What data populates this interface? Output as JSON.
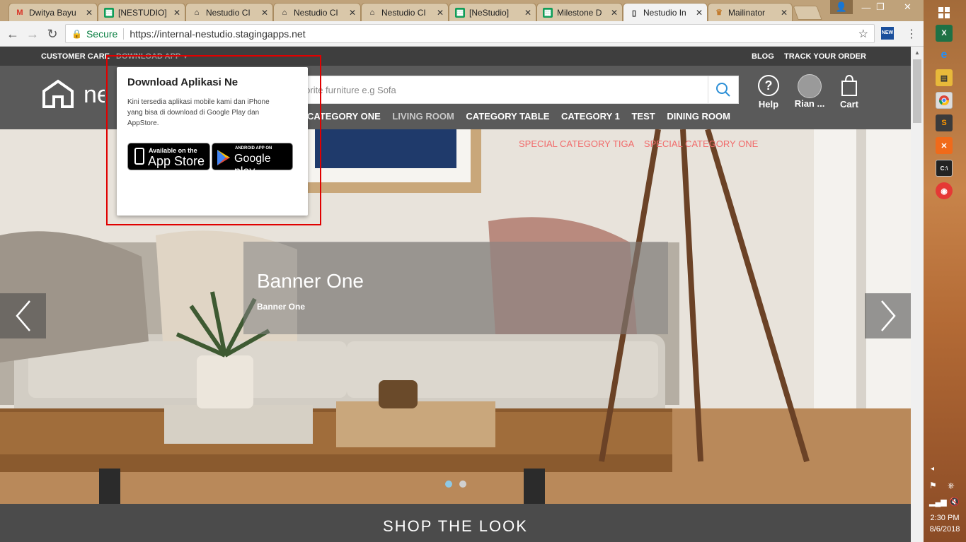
{
  "browser": {
    "tabs": [
      {
        "label": "Dwitya Bayu",
        "icon": "gmail-icon",
        "active": false
      },
      {
        "label": "[NESTUDIO]",
        "icon": "sheets-icon",
        "active": false
      },
      {
        "label": "Nestudio CI",
        "icon": "nestudio-icon",
        "active": false
      },
      {
        "label": "Nestudio CI",
        "icon": "nestudio-icon",
        "active": false
      },
      {
        "label": "Nestudio CI",
        "icon": "nestudio-icon",
        "active": false
      },
      {
        "label": "[NeStudio]",
        "icon": "sheets-icon",
        "active": false
      },
      {
        "label": "Milestone D",
        "icon": "sheets-icon",
        "active": false
      },
      {
        "label": "Nestudio In",
        "icon": "page-icon",
        "active": true
      },
      {
        "label": "Mailinator",
        "icon": "mailinator-icon",
        "active": false
      }
    ],
    "secure_label": "Secure",
    "url": "https://internal-nestudio.stagingapps.net"
  },
  "site": {
    "topbar": {
      "customer_care": "CUSTOMER CARE",
      "download_app": "DOWNLOAD APP",
      "blog": "BLOG",
      "track_order": "TRACK YOUR ORDER"
    },
    "search": {
      "placeholder": "Find your favorite furniture e.g Sofa"
    },
    "header_icons": {
      "help": "Help",
      "user": "Rian ...",
      "cart": "Cart"
    },
    "categories": [
      "CATEGORY ONE",
      "LIVING ROOM",
      "CATEGORY TABLE",
      "CATEGORY 1",
      "TEST",
      "DINING ROOM"
    ],
    "special_categories": [
      "SPECIAL CATEGORY TIGA",
      "SPECIAL CATEGORY ONE"
    ],
    "banner": {
      "title": "Banner One",
      "subtitle": "Banner One"
    },
    "shop_the_look": "SHOP THE LOOK",
    "popup": {
      "title": "Download Aplikasi Ne",
      "body": "Kini tersedia aplikasi mobile kami dan iPhone yang bisa di download di Google Play dan AppStore.",
      "appstore_small": "Available on the",
      "appstore_big": "App Store",
      "googleplay_small": "ANDROID APP ON",
      "googleplay_big": "Google play"
    }
  },
  "taskbar": {
    "time": "2:30 PM",
    "date": "8/6/2018"
  },
  "colors": {
    "special": "#f16b6b",
    "highlight": "#e00000",
    "secure": "#0b8043"
  }
}
